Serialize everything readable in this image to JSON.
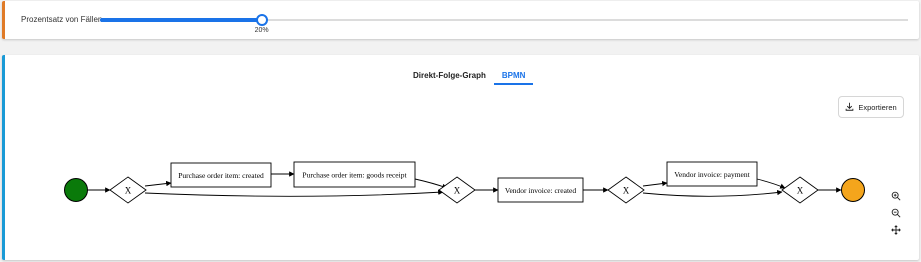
{
  "filter": {
    "label": "Prozentsatz von Fällen",
    "value_percent": 20,
    "value_label": "20%"
  },
  "tabs": [
    {
      "label": "Direkt-Folge-Graph",
      "active": false
    },
    {
      "label": "BPMN",
      "active": true
    }
  ],
  "export": {
    "label": "Exportieren"
  },
  "graph": {
    "activities": [
      {
        "id": "a1",
        "label": "Purchase order item: created"
      },
      {
        "id": "a2",
        "label": "Purchase order item: goods receipt"
      },
      {
        "id": "a3",
        "label": "Vendor invoice: created"
      },
      {
        "id": "a4",
        "label": "Vendor invoice: payment"
      }
    ],
    "gateway_symbol": "X"
  },
  "colors": {
    "accent": "#1a73e8",
    "start_event": "#0a7a0a",
    "end_event": "#f4a51c",
    "filter_border": "#e07b27",
    "graph_border": "#1a9ad6"
  }
}
